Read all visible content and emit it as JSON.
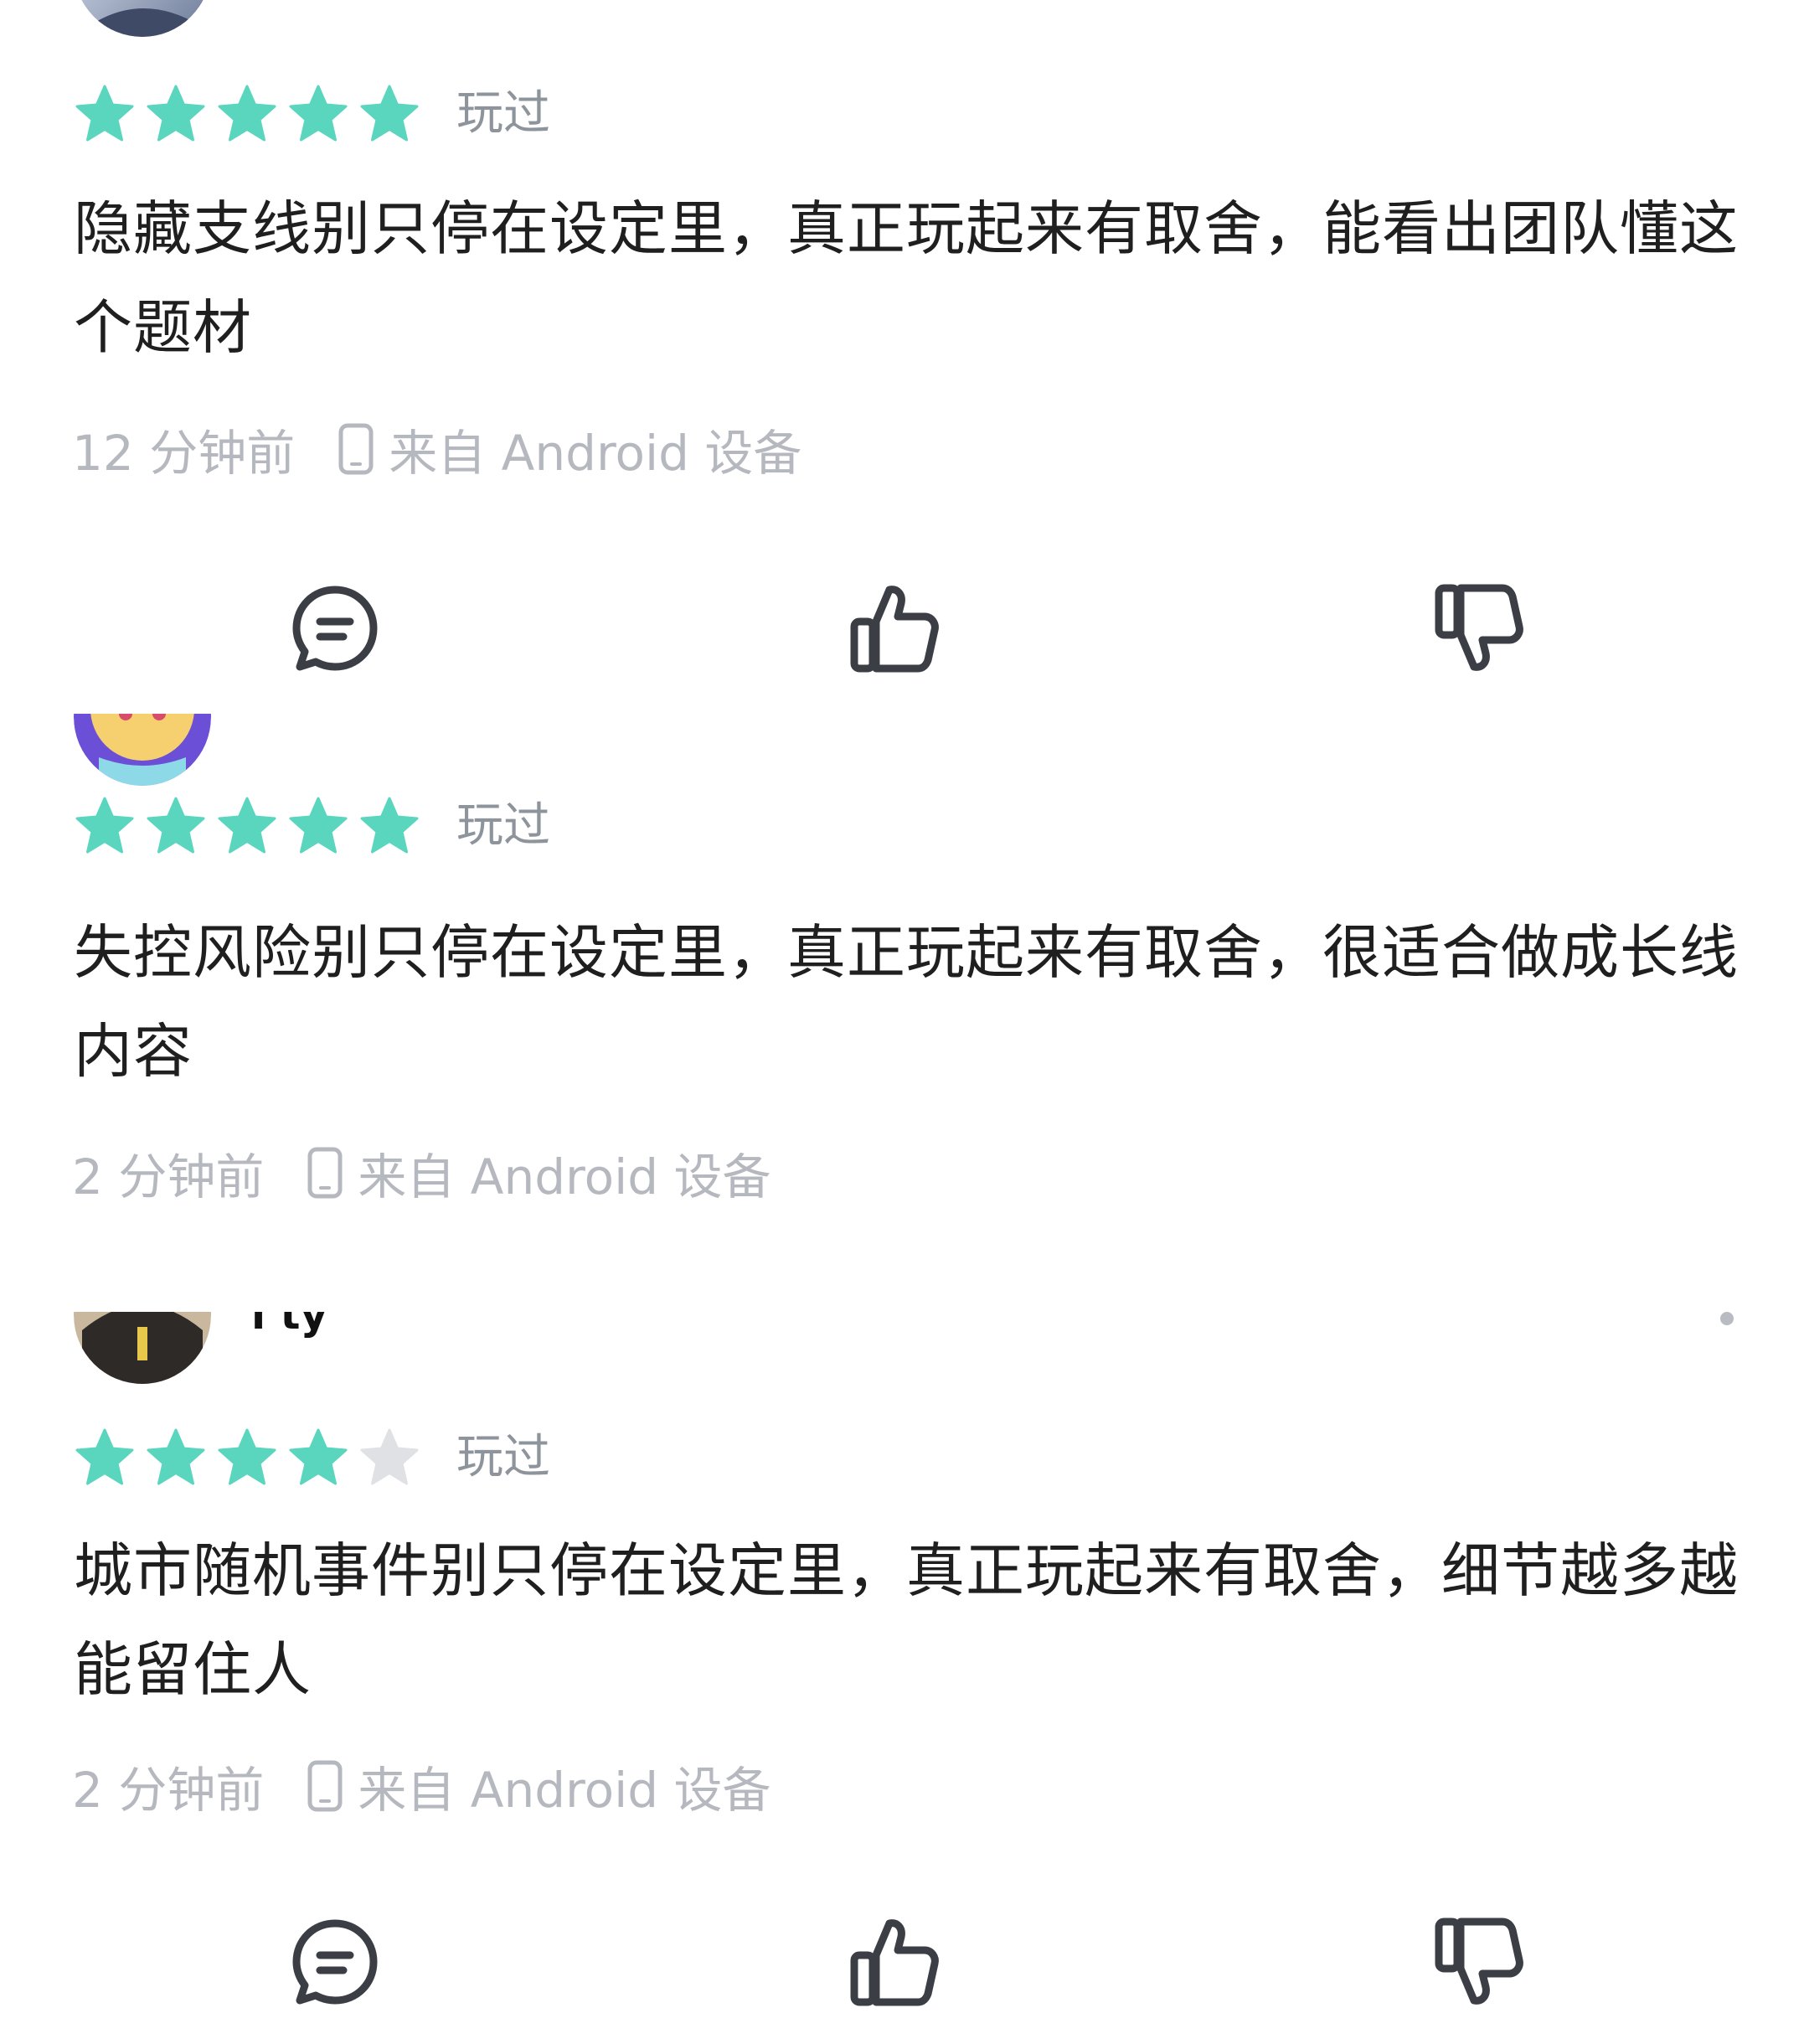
{
  "colors": {
    "star_filled": "#5ad6bf",
    "star_empty": "#dfe1e5",
    "meta_text": "#b5b9bf",
    "icon_stroke": "#3b3f45"
  },
  "reviews": [
    {
      "rating": 5,
      "status": "玩过",
      "content": "隐藏支线别只停在设定里，真正玩起来有取舍，能看出团队懂这个题材",
      "time": "12 分钟前",
      "device": "来自 Android 设备"
    },
    {
      "rating": 5,
      "status": "玩过",
      "content": "失控风险别只停在设定里，真正玩起来有取舍，很适合做成长线内容",
      "time": "2 分钟前",
      "device": "来自 Android 设备"
    },
    {
      "username": "l ty",
      "rating": 4,
      "status": "玩过",
      "content": "城市随机事件别只停在设定里，真正玩起来有取舍，细节越多越能留住人",
      "time": "2 分钟前",
      "device": "来自 Android 设备"
    }
  ],
  "icons": {
    "comment": "comment-icon",
    "like": "thumbs-up-icon",
    "dislike": "thumbs-down-icon",
    "device": "phone-icon",
    "more": "more-dot-icon"
  }
}
